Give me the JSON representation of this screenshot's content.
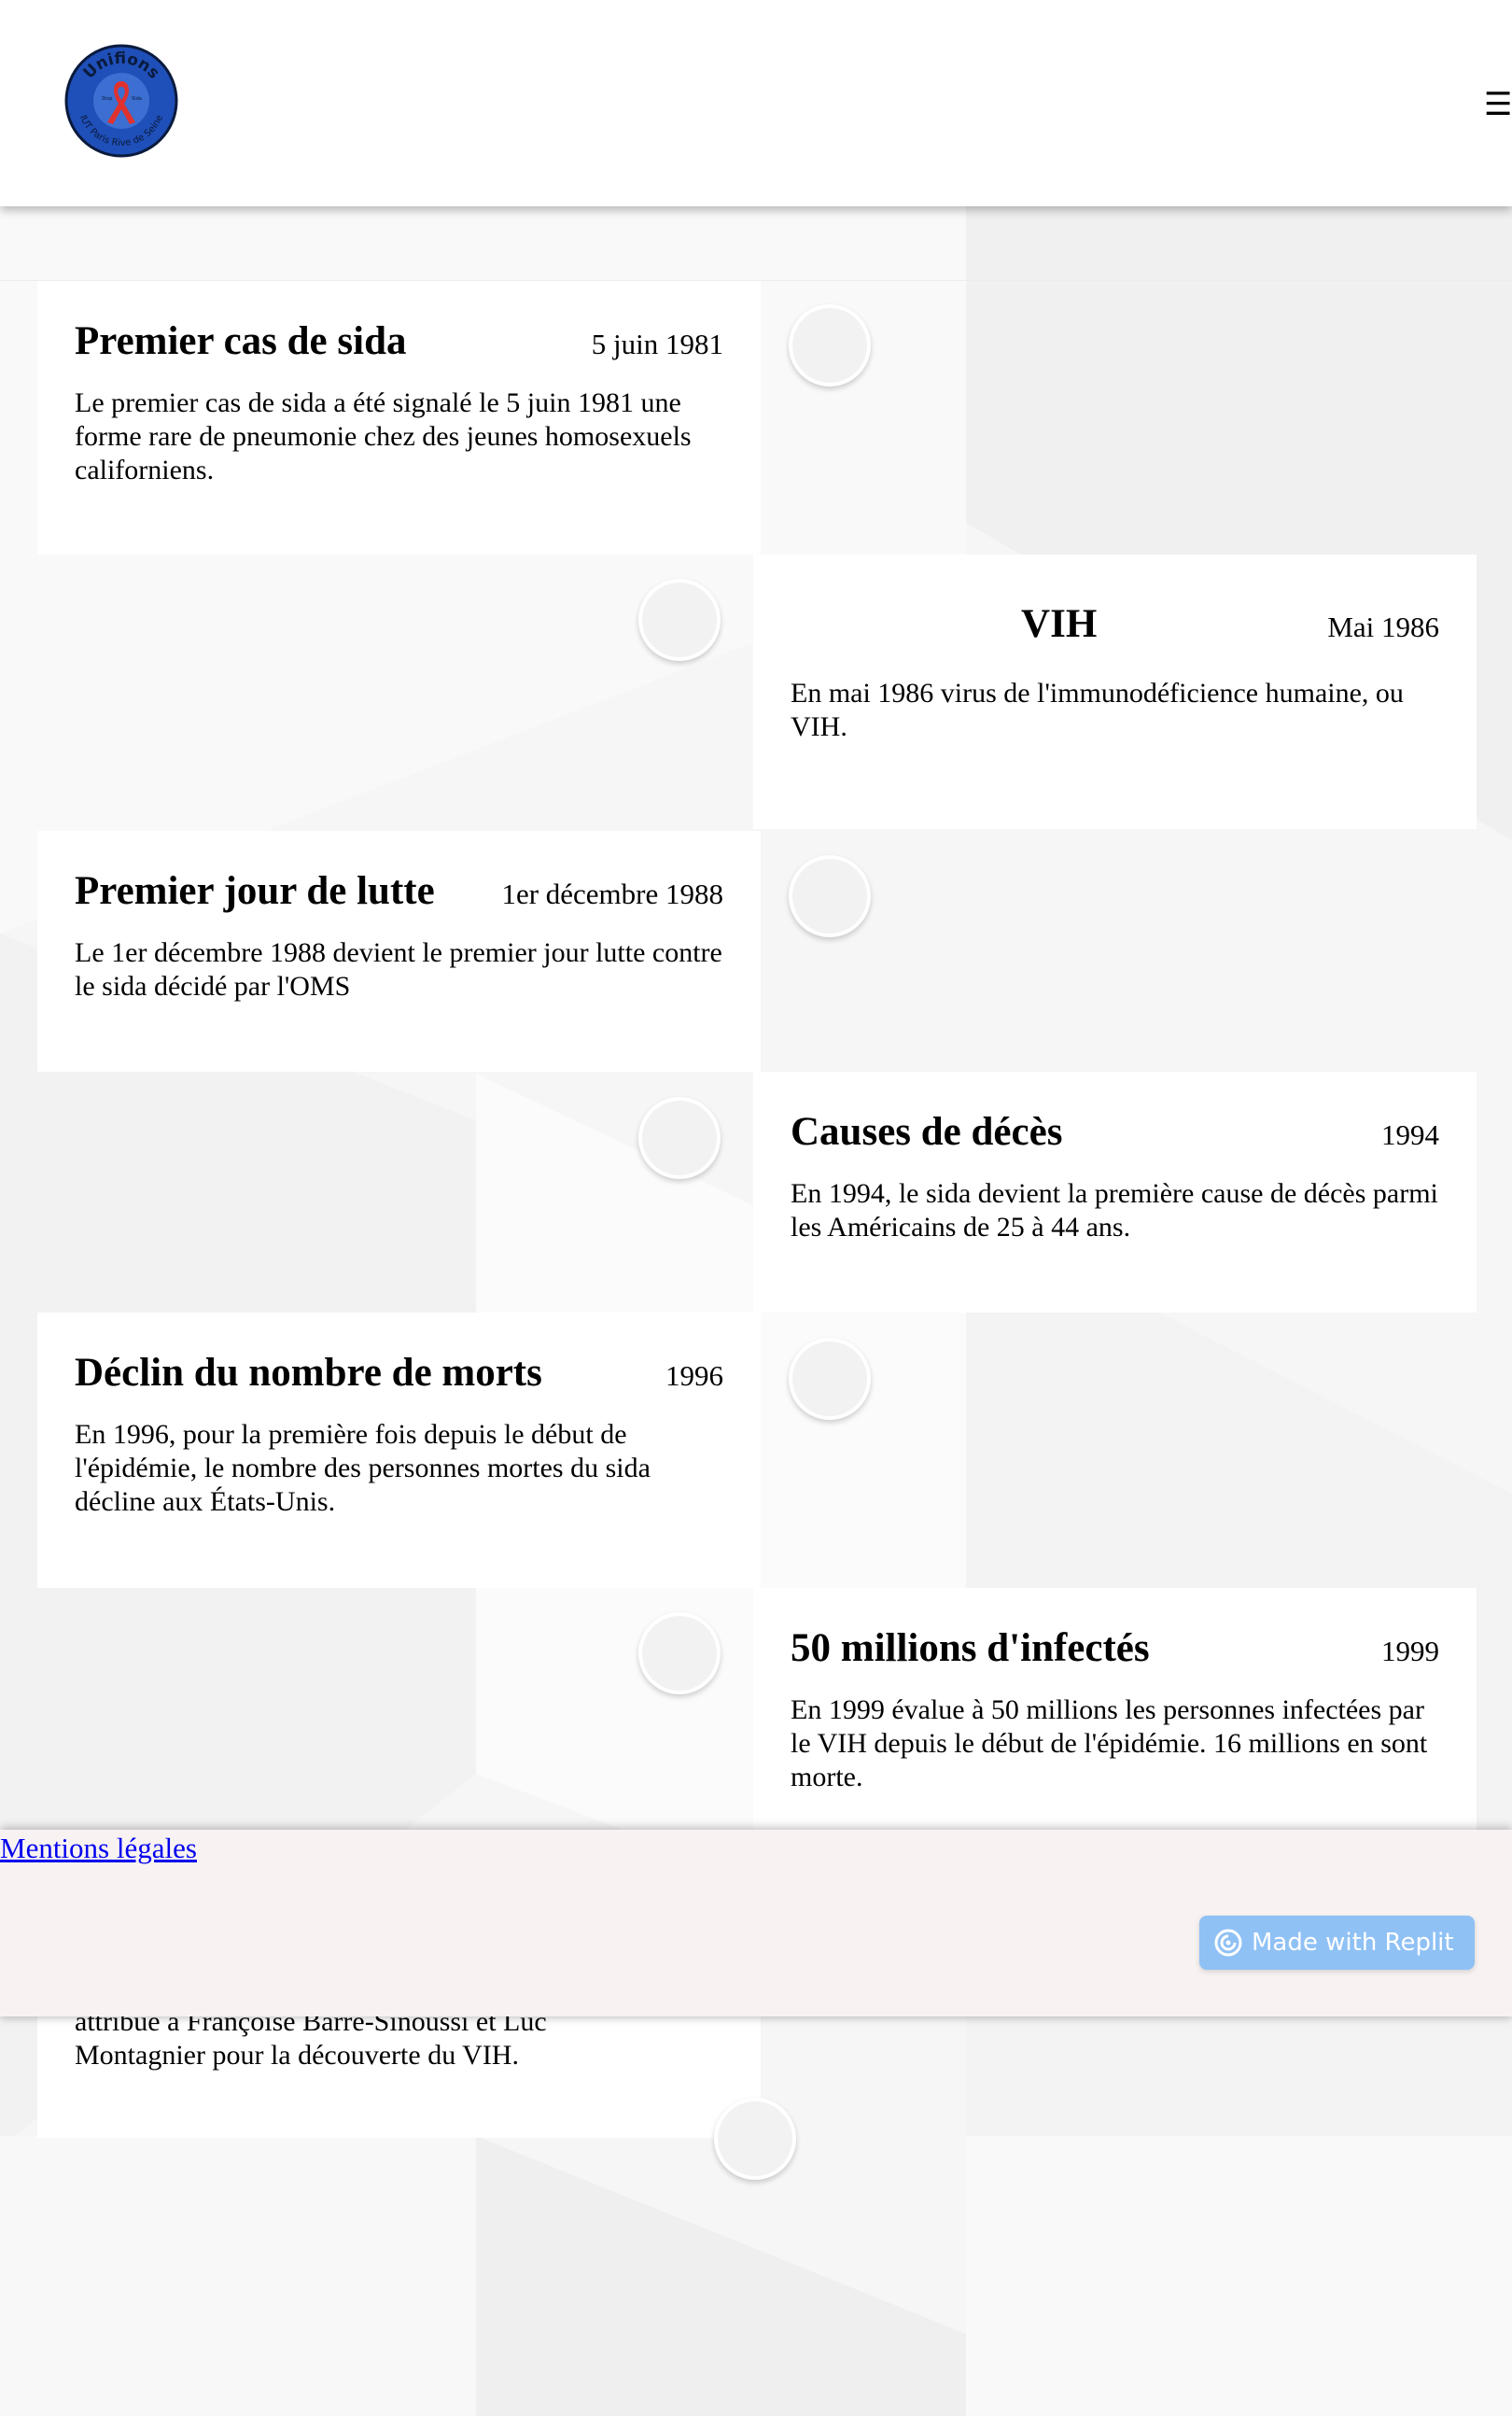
{
  "header": {
    "logo_text_top": "Unifions",
    "logo_text_bottom": "IUT Paris Rive de Seine",
    "logo_ribbon_left": "Stop",
    "logo_ribbon_right": "Sida",
    "menu_icon": "☰"
  },
  "timeline": [
    {
      "title": "Premier cas de sida",
      "date": "5 juin 1981",
      "text": "Le premier cas de sida a été signalé le 5 juin 1981 une forme rare de pneumonie chez des jeunes homosexuels californiens."
    },
    {
      "title": "VIH",
      "date": "Mai 1986",
      "text": "En mai 1986 virus de l'immunodéficience humaine, ou VIH."
    },
    {
      "title": "Premier jour de lutte",
      "date": "1er décembre 1988",
      "text": "Le 1er décembre 1988 devient le premier jour lutte contre le sida décidé par l'OMS"
    },
    {
      "title": "Causes de décès",
      "date": "1994",
      "text": "En 1994, le sida devient la première cause de décès parmi les Américains de 25 à 44 ans."
    },
    {
      "title": "Déclin du nombre de morts",
      "date": "1996",
      "text": "En 1996, pour la première fois depuis le début de l'épidémie, le nombre des personnes mortes du sida décline aux États-Unis."
    },
    {
      "title": "50 millions d'infectés",
      "date": "1999",
      "text": "En 1999 évalue à 50 millions les personnes infectées par le VIH depuis le début de l'épidémie. 16 millions en sont morte."
    },
    {
      "text_line_1": "attribué à Françoise Barré-Sinoussi et Luc",
      "text_line_2": "Montagnier pour la découverte du VIH."
    }
  ],
  "footer": {
    "legal_link": "Mentions légales",
    "replit_label": "Made with Replit"
  },
  "colors": {
    "logo_blue": "#1f4fb8",
    "ribbon_red": "#e0312e",
    "footer_bg": "#f8f3f2",
    "link": "#0000ee",
    "replit_button": "#8fc1f5"
  }
}
